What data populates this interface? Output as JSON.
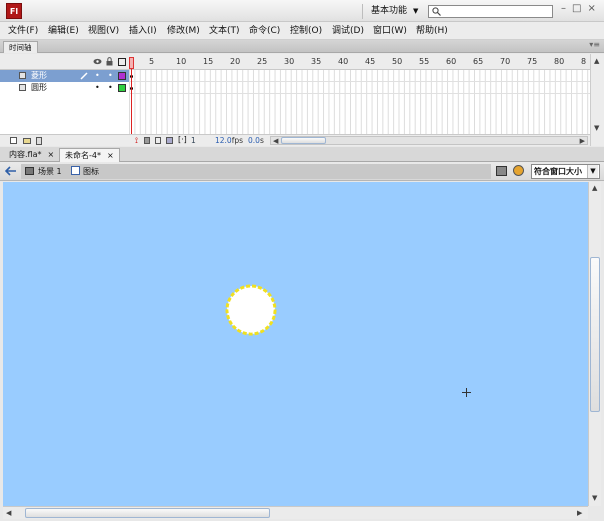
{
  "app": {
    "logo": "Fl",
    "workspace_label": "基本功能",
    "workspace_arrow": "▼",
    "search_placeholder": "",
    "window_controls": [
      "–",
      "□",
      "×"
    ]
  },
  "menu": [
    "文件(F)",
    "编辑(E)",
    "视图(V)",
    "插入(I)",
    "修改(M)",
    "文本(T)",
    "命令(C)",
    "控制(O)",
    "调试(D)",
    "窗口(W)",
    "帮助(H)"
  ],
  "timeline": {
    "tab_label": "时间轴",
    "frame_numbers": [
      "5",
      "10",
      "15",
      "20",
      "25",
      "30",
      "35",
      "40",
      "45",
      "50",
      "55",
      "60",
      "65",
      "70",
      "75",
      "80",
      "8"
    ],
    "layers": [
      {
        "name": "菱形",
        "selected": true,
        "color": "#b030d0"
      },
      {
        "name": "圆形",
        "selected": false,
        "color": "#30d040"
      }
    ],
    "status": {
      "current_frame": "1",
      "fps": "12.0",
      "fps_unit": "fps",
      "time": "0.0",
      "time_unit": "s"
    }
  },
  "doc_tabs": [
    {
      "label": "内容.fla*",
      "close": "×",
      "active": false
    },
    {
      "label": "未命名-4*",
      "close": "×",
      "active": true
    }
  ],
  "editbar": {
    "scene": "场景 1",
    "symbol": "图标",
    "zoom": "符合窗口大小"
  },
  "stage": {
    "background": "#99ccff"
  }
}
